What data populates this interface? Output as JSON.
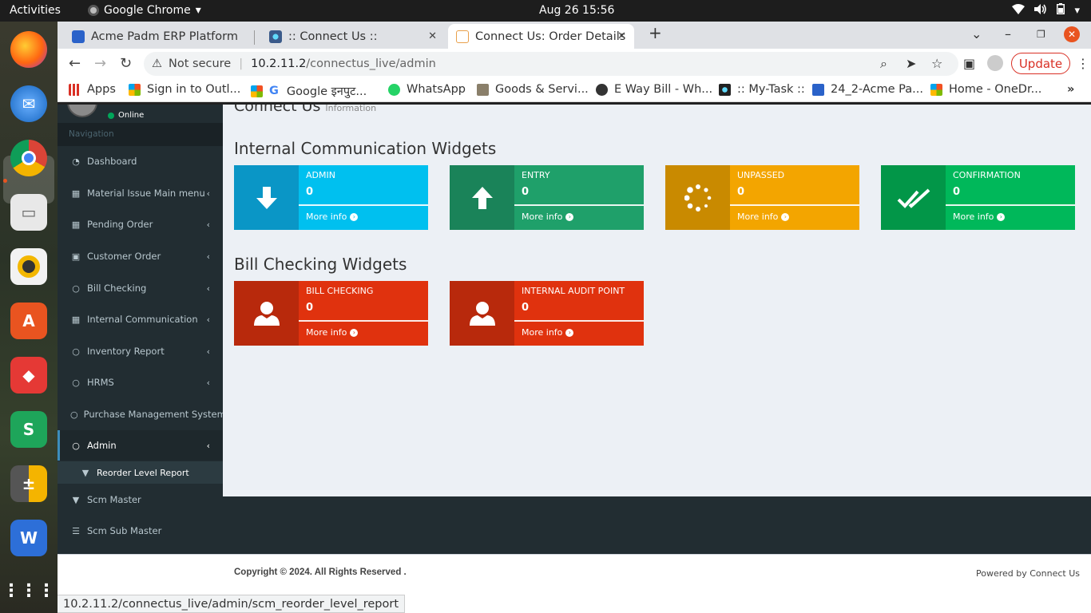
{
  "os": {
    "activities": "Activities",
    "app_name": "Google Chrome",
    "clock": "Aug 26  15:56"
  },
  "browser": {
    "tabs": [
      {
        "title": "Acme Padm ERP Platform",
        "active": false
      },
      {
        "title": ":: Connect Us ::",
        "active": false
      },
      {
        "title": "Connect Us: Order Details",
        "active": true
      }
    ],
    "address": {
      "security": "Not secure",
      "host": "10.2.11.2",
      "path": "/connectus_live/admin"
    },
    "update_label": "Update",
    "bookmarks": [
      {
        "label": "Apps"
      },
      {
        "label": "Sign in to Outl..."
      },
      {
        "label": "Google इनपुट..."
      },
      {
        "label": "WhatsApp"
      },
      {
        "label": "Goods & Servi..."
      },
      {
        "label": "E Way Bill - Wh..."
      },
      {
        "label": ":: My-Task ::"
      },
      {
        "label": "24_2-Acme Pa..."
      },
      {
        "label": "Home - OneDr..."
      }
    ],
    "status_url": "10.2.11.2/connectus_live/admin/scm_reorder_level_report"
  },
  "sidebar": {
    "status": "Online",
    "nav_header": "Navigation",
    "items": [
      {
        "label": "Dashboard",
        "icon": "dashboard-icon"
      },
      {
        "label": "Material Issue Main menu",
        "icon": "table-icon"
      },
      {
        "label": "Pending Order",
        "icon": "table-icon"
      },
      {
        "label": "Customer Order",
        "icon": "money-icon"
      },
      {
        "label": "Bill Checking",
        "icon": "circle-icon"
      },
      {
        "label": "Internal Communication",
        "icon": "table-icon"
      },
      {
        "label": "Inventory Report",
        "icon": "circle-icon"
      },
      {
        "label": "HRMS",
        "icon": "circle-icon"
      },
      {
        "label": "Purchase Management System",
        "icon": "circle-icon"
      },
      {
        "label": "Admin",
        "icon": "circle-icon"
      },
      {
        "label": "Reorder Level Report",
        "icon": "filter-icon"
      },
      {
        "label": "Scm Master",
        "icon": "filter-icon"
      },
      {
        "label": "Scm Sub Master",
        "icon": "list-icon"
      }
    ]
  },
  "content": {
    "page_title": "Connect Us",
    "page_subtitle": "Information",
    "sections": [
      {
        "title": "Internal Communication Widgets",
        "widgets": [
          {
            "label": "ADMIN",
            "value": "0",
            "more": "More info",
            "color": "#00c0ef",
            "icon_bg": "#0a96c6",
            "icon": "arrow-down-icon"
          },
          {
            "label": "ENTRY",
            "value": "0",
            "more": "More info",
            "color": "#1fa06a",
            "icon_bg": "#1a8359",
            "icon": "arrow-up-icon"
          },
          {
            "label": "UNPASSED",
            "value": "0",
            "more": "More info",
            "color": "#f3a500",
            "icon_bg": "#c98a00",
            "icon": "spinner-icon"
          },
          {
            "label": "CONFIRMATION",
            "value": "0",
            "more": "More info",
            "color": "#00b85a",
            "icon_bg": "#029648",
            "icon": "double-check-icon"
          }
        ]
      },
      {
        "title": "Bill Checking Widgets",
        "widgets": [
          {
            "label": "BILL CHECKING",
            "value": "0",
            "more": "More info",
            "color": "#e0320e",
            "icon_bg": "#b8290c",
            "icon": "user-icon"
          },
          {
            "label": "INTERNAL AUDIT POINT",
            "value": "0",
            "more": "More info",
            "color": "#e0320e",
            "icon_bg": "#b8290c",
            "icon": "user-icon"
          }
        ]
      }
    ]
  },
  "footer": {
    "copyright": "Copyright © 2024. All Rights Reserved .",
    "powered": "Powered by Connect Us"
  }
}
